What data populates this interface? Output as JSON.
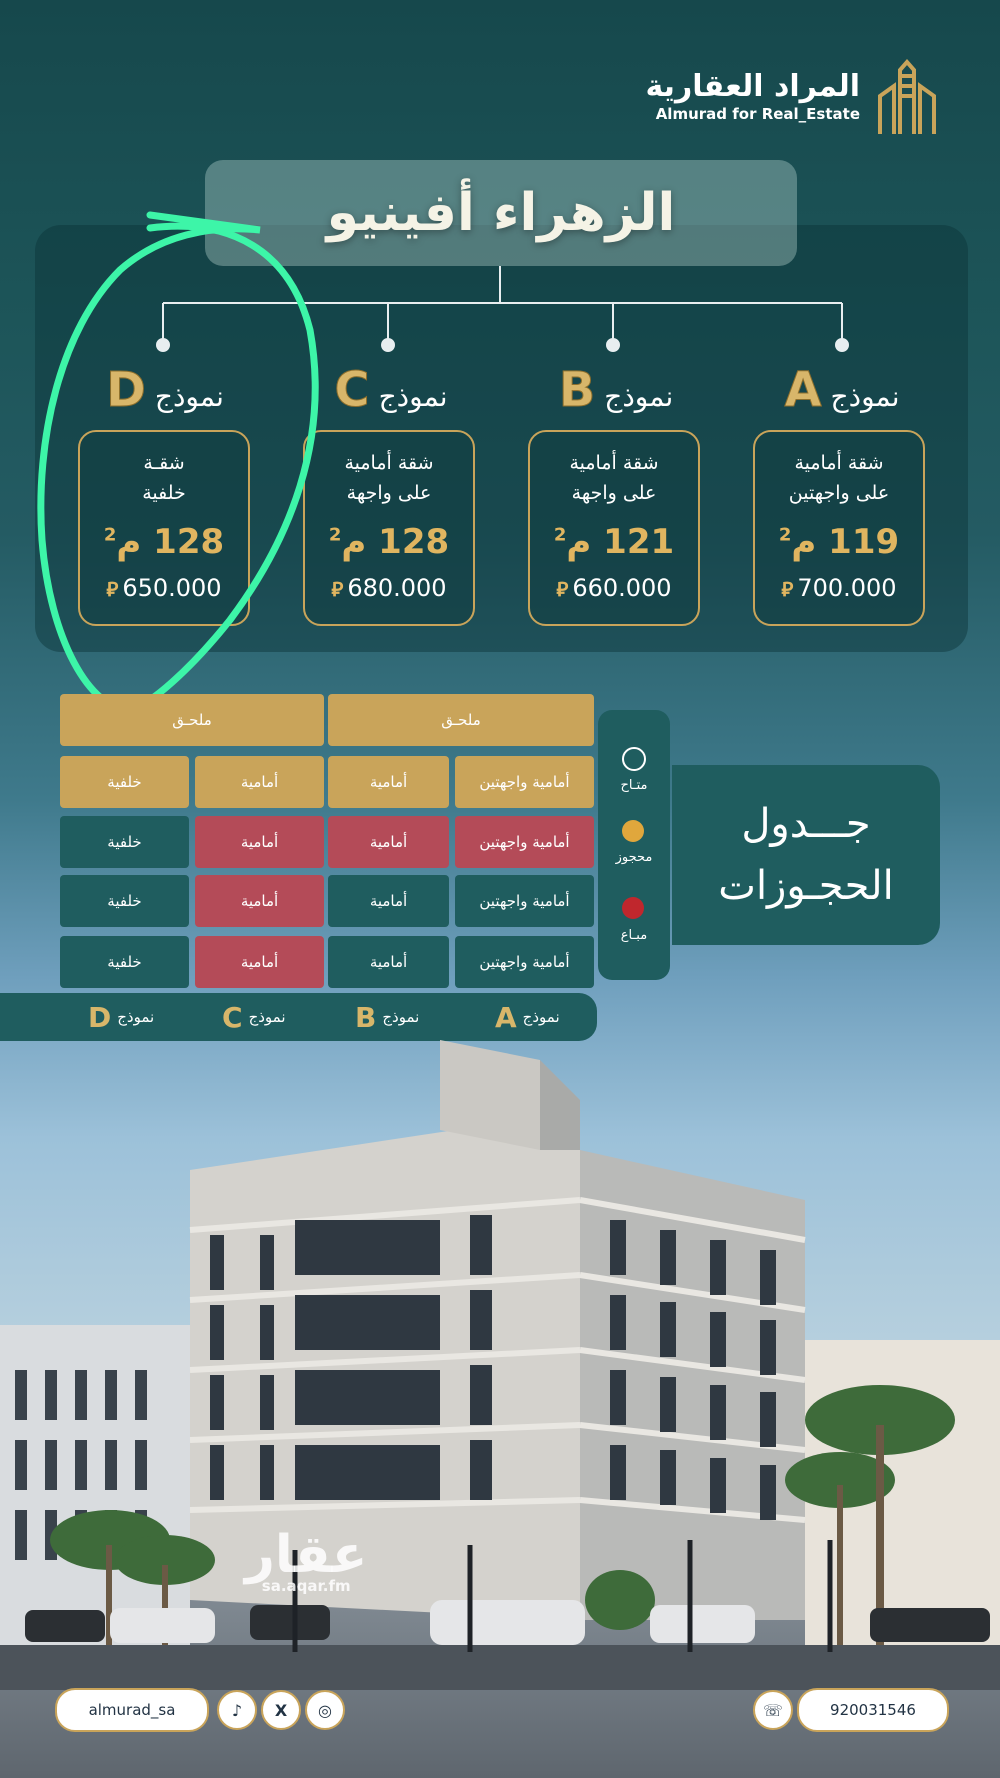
{
  "brand": {
    "name_ar": "المراد العقارية",
    "name_en": "Almurad for Real_Estate"
  },
  "project": {
    "title": "الزهراء أفينيو"
  },
  "model_word": "نموذج",
  "models": [
    {
      "letter": "A",
      "desc": "شقة أمامية\nعلى واجهتين",
      "area": "119 م",
      "price": "700.000"
    },
    {
      "letter": "B",
      "desc": "شقة أمامية\nعلى واجهة",
      "area": "121 م",
      "price": "660.000"
    },
    {
      "letter": "C",
      "desc": "شقة أمامية\nعلى واجهة",
      "area": "128 م",
      "price": "680.000"
    },
    {
      "letter": "D",
      "desc": "شقـة\nخلفية",
      "area": "128 م",
      "price": "650.000"
    }
  ],
  "currency_symbol": "⃁",
  "reservations": {
    "title_line1": "جـــدول",
    "title_line2": "الحجـوزات",
    "annex_label": "ملحـق",
    "legend": [
      {
        "label": "متـاح",
        "color": "#1f5d5f"
      },
      {
        "label": "محجوز",
        "color": "#e0a73c"
      },
      {
        "label": "مبـاع",
        "color": "#c0272d"
      }
    ],
    "rows": [
      [
        "أمامية واجهتين",
        "أمامية",
        "أمامية",
        "خلفية"
      ],
      [
        "أمامية واجهتين",
        "أمامية",
        "أمامية",
        "خلفية"
      ],
      [
        "أمامية واجهتين",
        "أمامية",
        "أمامية",
        "خلفية"
      ],
      [
        "أمامية واجهتين",
        "أمامية",
        "أمامية",
        "خلفية"
      ]
    ]
  },
  "watermark": {
    "ar": "عقار",
    "en": "sa.aqar.fm"
  },
  "footer": {
    "handle": "almurad_sa",
    "phone": "920031546"
  },
  "colors": {
    "gold": "#c9a45a",
    "teal": "#1f5d5f",
    "red": "#b44b58",
    "highlight": "#3df5a8"
  }
}
